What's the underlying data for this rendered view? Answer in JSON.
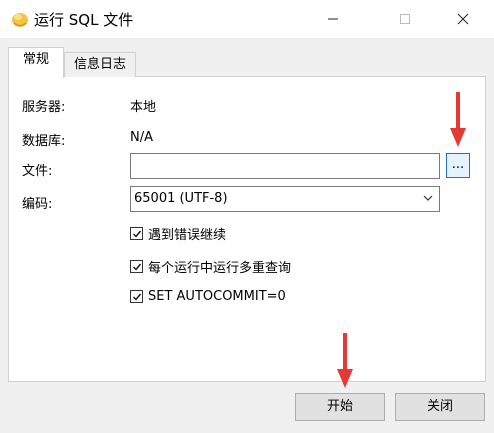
{
  "window": {
    "title": "运行 SQL 文件",
    "controls": {
      "minimize": "—",
      "maximize": "☐",
      "close": "✕"
    }
  },
  "tabs": [
    {
      "label": "常规",
      "active": true
    },
    {
      "label": "信息日志",
      "active": false
    }
  ],
  "form": {
    "server_label": "服务器:",
    "server_value": "本地",
    "database_label": "数据库:",
    "database_value": "N/A",
    "file_label": "文件:",
    "file_value": "",
    "browse_label": "...",
    "encoding_label": "编码:",
    "encoding_value": "65001 (UTF-8)"
  },
  "options": [
    {
      "label": "遇到错误继续",
      "checked": true
    },
    {
      "label": "每个运行中运行多重查询",
      "checked": true
    },
    {
      "label": "SET AUTOCOMMIT=0",
      "checked": true
    }
  ],
  "buttons": {
    "start": "开始",
    "close": "关闭"
  },
  "colors": {
    "annotation_arrow": "#e53935",
    "focus_border": "#1f6fd1"
  }
}
